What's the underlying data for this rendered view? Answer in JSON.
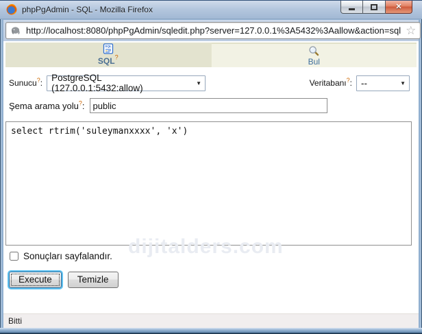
{
  "window": {
    "title": "phpPgAdmin - SQL - Mozilla Firefox"
  },
  "browser": {
    "url": "http://localhost:8080/phpPgAdmin/sqledit.php?server=127.0.0.1%3A5432%3Aallow&action=sql"
  },
  "icons": {
    "help": "?",
    "colon": ":",
    "star": "☆",
    "dropdown_arrow": "▼",
    "close": "✕"
  },
  "tabs": [
    {
      "label": "SQL",
      "icon": "sql-document-icon",
      "active": true
    },
    {
      "label": "Bul",
      "icon": "magnifier-icon",
      "active": false
    }
  ],
  "form": {
    "server_label": "Sunucu",
    "server_value": "PostgreSQL (127.0.0.1:5432:allow)",
    "database_label": "Veritabanı",
    "database_value": "--",
    "schema_label": "Şema arama yolu",
    "schema_value": "public",
    "query": "select rtrim('suleymanxxxx', 'x')",
    "paginate_label": "Sonuçları sayfalandır.",
    "execute_label": "Execute",
    "clear_label": "Temizle"
  },
  "watermark": "dijitalders.com",
  "statusbar": {
    "text": "Bitti"
  },
  "colors": {
    "tab_active_bg": "#e3e3cf",
    "tab_inactive_bg": "#f2f2e4",
    "help_orange": "#cc6600",
    "tab_link_blue": "#3e6e9c",
    "default_button_glow": "#5fc1f0",
    "title_bar_blue": "#b3c6dd",
    "status_bg": "#f1eeee"
  }
}
